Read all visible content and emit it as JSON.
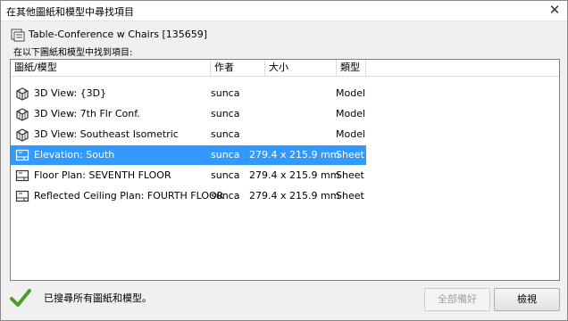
{
  "window": {
    "title": "在其他圖紙和模型中尋找項目",
    "close_glyph": "✕"
  },
  "element": {
    "name": "Table-Conference w Chairs [135659]",
    "icon": "family-element-icon"
  },
  "found_label": "在以下圖紙和模型中找到項目:",
  "table": {
    "columns": {
      "name": "圖紙/模型",
      "author": "作者",
      "size": "大小",
      "type": "類型"
    },
    "rows": [
      {
        "icon": "3d-view-icon",
        "name": "3D View: {3D}",
        "author": "sunca",
        "size": "",
        "type": "Model",
        "selected": false
      },
      {
        "icon": "3d-view-icon",
        "name": "3D View: 7th Flr Conf.",
        "author": "sunca",
        "size": "",
        "type": "Model",
        "selected": false
      },
      {
        "icon": "3d-view-icon",
        "name": "3D View: Southeast Isometric",
        "author": "sunca",
        "size": "",
        "type": "Model",
        "selected": false
      },
      {
        "icon": "sheet-icon",
        "name": "Elevation: South",
        "author": "sunca",
        "size": "279.4 x 215.9 mm",
        "type": "Sheet",
        "selected": true
      },
      {
        "icon": "sheet-icon",
        "name": "Floor Plan: SEVENTH FLOOR",
        "author": "sunca",
        "size": "279.4 x 215.9 mm",
        "type": "Sheet",
        "selected": false
      },
      {
        "icon": "sheet-icon",
        "name": "Reflected Ceiling Plan: FOURTH FLOOR",
        "author": "sunca",
        "size": "279.4 x 215.9 mm",
        "type": "Sheet",
        "selected": false
      }
    ]
  },
  "status": {
    "icon": "checkmark-icon",
    "text": "已搜尋所有圖紙和模型。",
    "color": "#4a9c2d"
  },
  "buttons": {
    "done": "全部備好",
    "view": "檢視"
  },
  "colors": {
    "selection": "#3399ff"
  }
}
